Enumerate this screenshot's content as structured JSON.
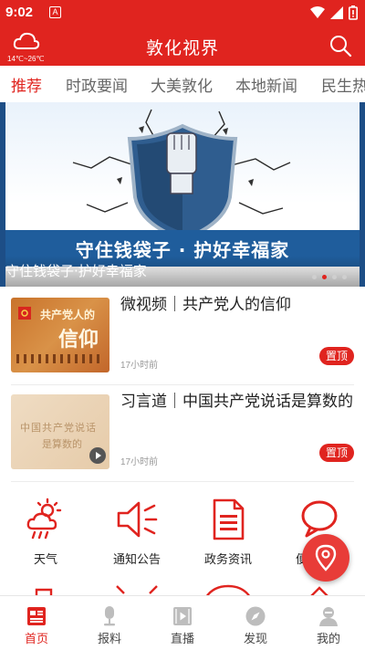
{
  "status_bar": {
    "time": "9:02",
    "notification_badge": "A"
  },
  "header": {
    "title": "敦化视界",
    "weather": {
      "temperature_range": "14℃~26℃",
      "icon": "cloud-icon"
    },
    "search_icon": "search-icon"
  },
  "tabs": [
    {
      "label": "推荐",
      "active": true
    },
    {
      "label": "时政要闻",
      "active": false
    },
    {
      "label": "大美敦化",
      "active": false
    },
    {
      "label": "本地新闻",
      "active": false
    },
    {
      "label": "民生热",
      "active": false
    }
  ],
  "banner": {
    "heading": "守住钱袋子 · 护好幸福家",
    "caption": "守住钱袋子·护好幸福家",
    "slide_count": 4,
    "active_slide": 2
  },
  "news": [
    {
      "title": "微视频｜共产党人的信仰",
      "time": "17小时前",
      "badge": "置顶",
      "thumb_text": "共产党人的信仰"
    },
    {
      "title": "习言道｜中国共产党说话是算数的",
      "time": "17小时前",
      "badge": "置顶",
      "thumb_text": "中国共产党说话是算数的"
    }
  ],
  "services": [
    {
      "label": "天气",
      "icon": "weather-icon"
    },
    {
      "label": "通知公告",
      "icon": "megaphone-icon"
    },
    {
      "label": "政务资讯",
      "icon": "document-icon"
    },
    {
      "label": "便",
      "icon": "chat-bubble-icon"
    }
  ],
  "fab": {
    "icon": "location-pin-icon"
  },
  "bottom_nav": [
    {
      "label": "首页",
      "icon": "home-news-icon",
      "active": true
    },
    {
      "label": "报料",
      "icon": "microphone-icon",
      "active": false
    },
    {
      "label": "直播",
      "icon": "play-video-icon",
      "active": false
    },
    {
      "label": "发现",
      "icon": "compass-icon",
      "active": false
    },
    {
      "label": "我的",
      "icon": "user-icon",
      "active": false
    }
  ],
  "colors": {
    "primary": "#e0241f",
    "banner_blue": "#1f5d9c"
  }
}
